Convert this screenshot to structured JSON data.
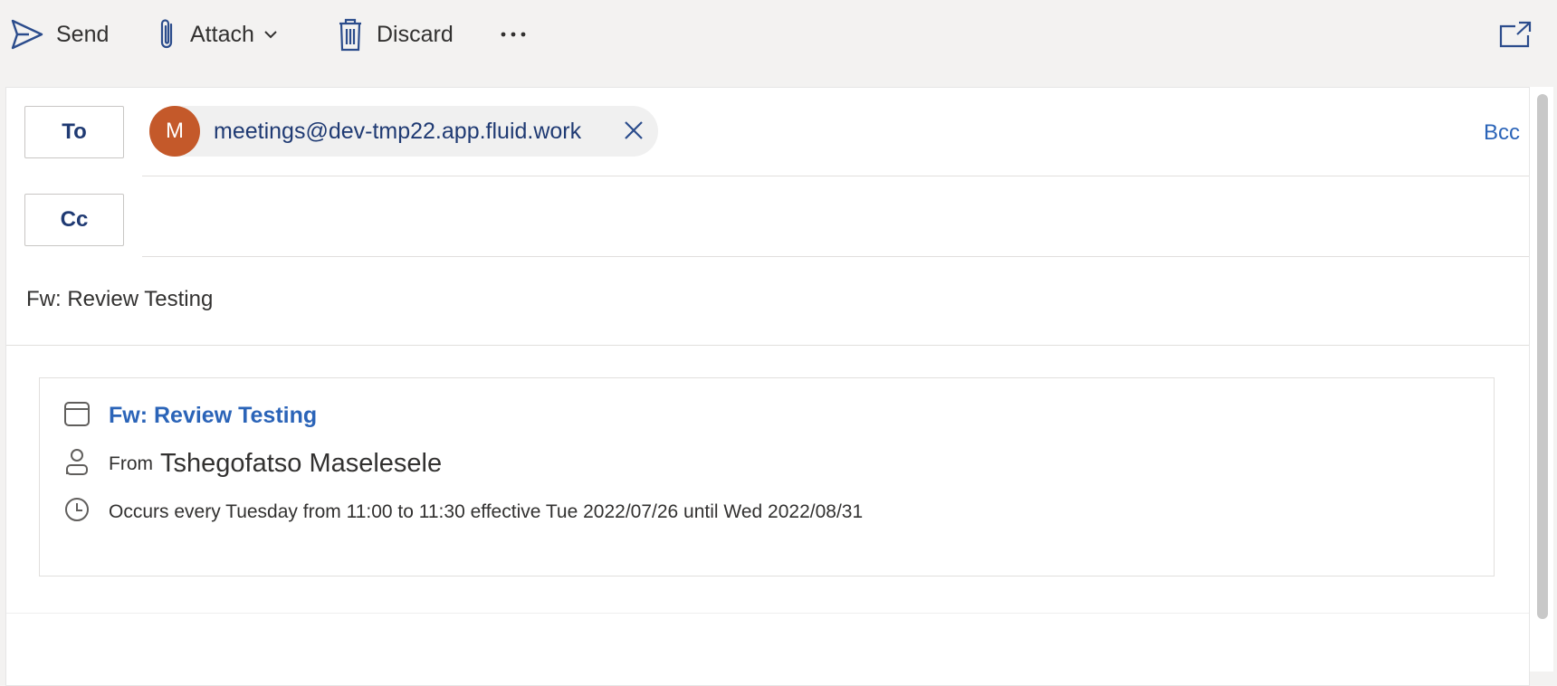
{
  "toolbar": {
    "send_label": "Send",
    "attach_label": "Attach",
    "discard_label": "Discard",
    "more_label": "···"
  },
  "recipients": {
    "to_label": "To",
    "cc_label": "Cc",
    "bcc_label": "Bcc",
    "to_chips": [
      {
        "initial": "M",
        "email": "meetings@dev-tmp22.app.fluid.work",
        "avatar_color": "#c4592a"
      }
    ]
  },
  "subject": "Fw: Review Testing",
  "meeting_card": {
    "title": "Fw: Review Testing",
    "from_label": "From",
    "from_name": "Tshegofatso Maselesele",
    "occurrence": "Occurs every Tuesday from 11:00 to 11:30 effective Tue 2022/07/26 until Wed 2022/08/31"
  },
  "colors": {
    "accent_link": "#2b64b8",
    "field_label": "#1f3a73",
    "avatar": "#c4592a",
    "toolbar_bg": "#f3f2f1"
  },
  "icons": [
    "send-icon",
    "paperclip-icon",
    "chevron-down-icon",
    "trash-icon",
    "more-icon",
    "popout-icon",
    "close-icon",
    "calendar-icon",
    "person-icon",
    "clock-icon"
  ]
}
